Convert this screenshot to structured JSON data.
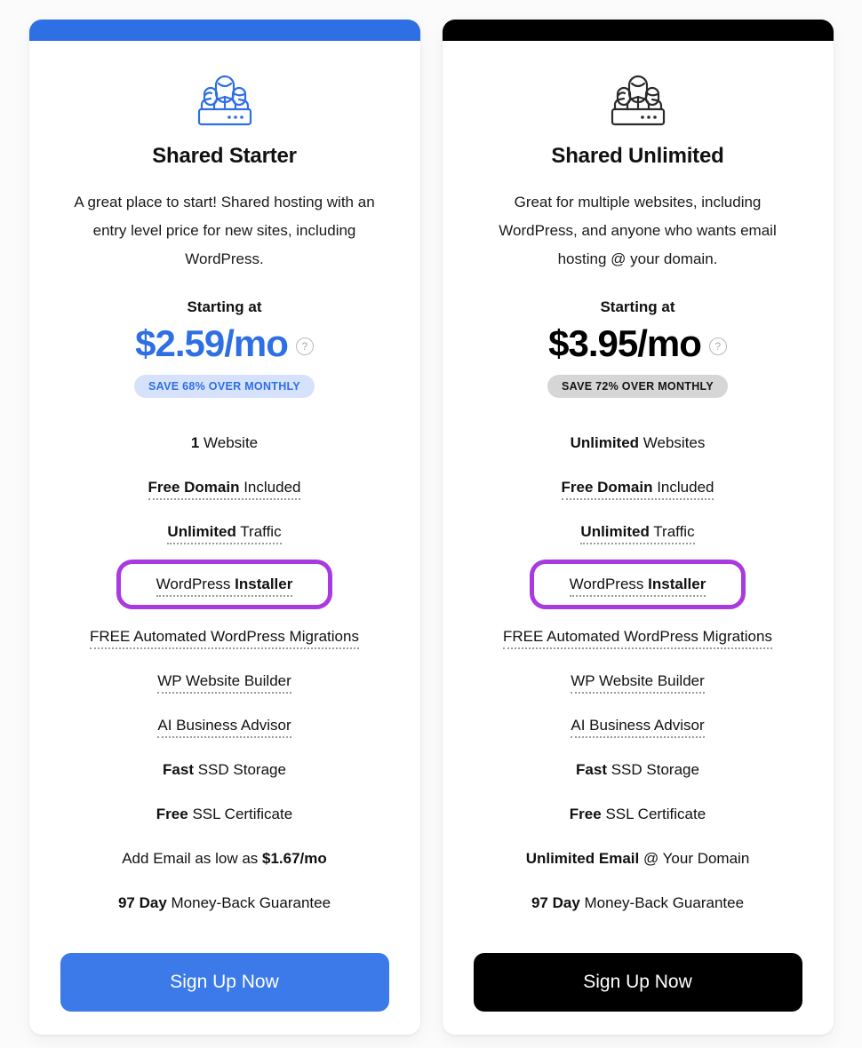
{
  "plans": [
    {
      "accent": "#2f6fe4",
      "theme": "blue",
      "icon_name": "team-panel-icon",
      "name": "Shared Starter",
      "description": "A great place to start! Shared hosting with an entry level price for new sites, including WordPress.",
      "starting_label": "Starting at",
      "price": "$2.59/mo",
      "help_glyph": "?",
      "save_badge": "SAVE 68% OVER MONTHLY",
      "features": [
        {
          "bold": "1",
          "rest": " Website",
          "dotted": false,
          "highlight": false
        },
        {
          "bold": "Free Domain",
          "rest": " Included",
          "dotted": true,
          "highlight": false
        },
        {
          "bold": "Unlimited",
          "rest": " Traffic",
          "dotted": true,
          "highlight": false
        },
        {
          "bold": "",
          "rest": "WordPress Installer",
          "bold_tail": "Installer",
          "lead": "WordPress ",
          "dotted": true,
          "highlight": true
        },
        {
          "bold": "",
          "rest": "FREE Automated WordPress Migrations",
          "dotted": true,
          "highlight": false
        },
        {
          "bold": "",
          "rest": "WP Website Builder",
          "dotted": true,
          "highlight": false
        },
        {
          "bold": "",
          "rest": "AI Business Advisor",
          "dotted": true,
          "highlight": false
        },
        {
          "bold": "Fast",
          "rest": " SSD Storage",
          "dotted": false,
          "highlight": false
        },
        {
          "bold": "Free",
          "rest": " SSL Certificate",
          "dotted": false,
          "highlight": false
        },
        {
          "lead": "Add Email as low as ",
          "bold_tail": "$1.67/mo",
          "dotted": false,
          "highlight": false
        },
        {
          "bold": "97 Day",
          "rest": " Money-Back Guarantee",
          "dotted": false,
          "highlight": false
        }
      ],
      "cta_label": "Sign Up Now"
    },
    {
      "accent": "#000000",
      "theme": "black",
      "icon_name": "team-panel-icon",
      "name": "Shared Unlimited",
      "description": "Great for multiple websites, including WordPress, and anyone who wants email hosting @ your domain.",
      "starting_label": "Starting at",
      "price": "$3.95/mo",
      "help_glyph": "?",
      "save_badge": "SAVE 72% OVER MONTHLY",
      "features": [
        {
          "bold": "Unlimited",
          "rest": " Websites",
          "dotted": false,
          "highlight": false
        },
        {
          "bold": "Free Domain",
          "rest": " Included",
          "dotted": true,
          "highlight": false
        },
        {
          "bold": "Unlimited",
          "rest": " Traffic",
          "dotted": true,
          "highlight": false
        },
        {
          "lead": "WordPress ",
          "bold_tail": "Installer",
          "dotted": true,
          "highlight": true
        },
        {
          "bold": "",
          "rest": "FREE Automated WordPress Migrations",
          "dotted": true,
          "highlight": false
        },
        {
          "bold": "",
          "rest": "WP Website Builder",
          "dotted": true,
          "highlight": false
        },
        {
          "bold": "",
          "rest": "AI Business Advisor",
          "dotted": true,
          "highlight": false
        },
        {
          "bold": "Fast",
          "rest": " SSD Storage",
          "dotted": false,
          "highlight": false
        },
        {
          "bold": "Free",
          "rest": " SSL Certificate",
          "dotted": false,
          "highlight": false
        },
        {
          "bold": "Unlimited Email",
          "rest": " @ Your Domain",
          "dotted": false,
          "highlight": false
        },
        {
          "bold": "97 Day",
          "rest": " Money-Back Guarantee",
          "dotted": false,
          "highlight": false
        }
      ],
      "cta_label": "Sign Up Now"
    }
  ],
  "colors": {
    "blue_accent": "#2f6fe4",
    "blue_button": "#3b7ae8",
    "black_accent": "#000000",
    "highlight_purple": "#a93ae0",
    "badge_blue_bg": "#d6e2fb",
    "badge_gray_bg": "#d6d6d6",
    "page_bg": "#fbfbfc"
  }
}
